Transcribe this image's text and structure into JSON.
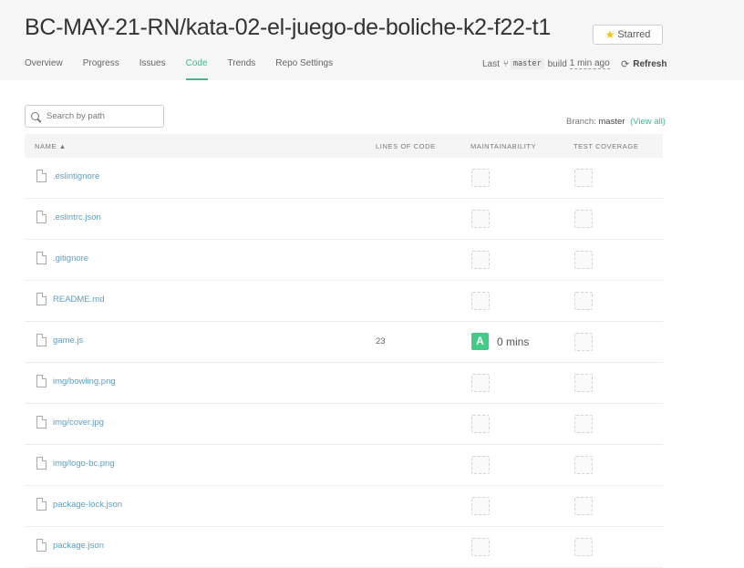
{
  "repo": {
    "title": "BC-MAY-21-RN/kata-02-el-juego-de-boliche-k2-f22-t1",
    "star_label": "Starred"
  },
  "tabs": [
    {
      "label": "Overview"
    },
    {
      "label": "Progress"
    },
    {
      "label": "Issues"
    },
    {
      "label": "Code",
      "active": true
    },
    {
      "label": "Trends"
    },
    {
      "label": "Repo Settings"
    }
  ],
  "build": {
    "prefix": "Last",
    "branch": "master",
    "word": "build",
    "ago": "1 min ago",
    "refresh": "Refresh"
  },
  "search": {
    "placeholder": "Search by path"
  },
  "branch": {
    "label": "Branch:",
    "name": "master",
    "view_all": "(View all)"
  },
  "table": {
    "headers": {
      "name": "NAME ▲",
      "loc": "LINES OF CODE",
      "maint": "MAINTAINABILITY",
      "cov": "TEST COVERAGE"
    },
    "rows": [
      {
        "name": ".eslintignore",
        "loc": "",
        "grade": "",
        "time": ""
      },
      {
        "name": ".eslintrc.json",
        "loc": "",
        "grade": "",
        "time": ""
      },
      {
        "name": ".gitignore",
        "loc": "",
        "grade": "",
        "time": ""
      },
      {
        "name": "README.md",
        "loc": "",
        "grade": "",
        "time": ""
      },
      {
        "name": "game.js",
        "loc": "23",
        "grade": "A",
        "time": "0 mins"
      },
      {
        "name": "img/bowling.png",
        "loc": "",
        "grade": "",
        "time": ""
      },
      {
        "name": "img/cover.jpg",
        "loc": "",
        "grade": "",
        "time": ""
      },
      {
        "name": "img/logo-bc.png",
        "loc": "",
        "grade": "",
        "time": ""
      },
      {
        "name": "package-lock.json",
        "loc": "",
        "grade": "",
        "time": ""
      },
      {
        "name": "package.json",
        "loc": "",
        "grade": "",
        "time": ""
      }
    ]
  },
  "colors": {
    "accent": "#3db98a",
    "grade_a": "#45c987",
    "link": "#5a9fc9"
  }
}
